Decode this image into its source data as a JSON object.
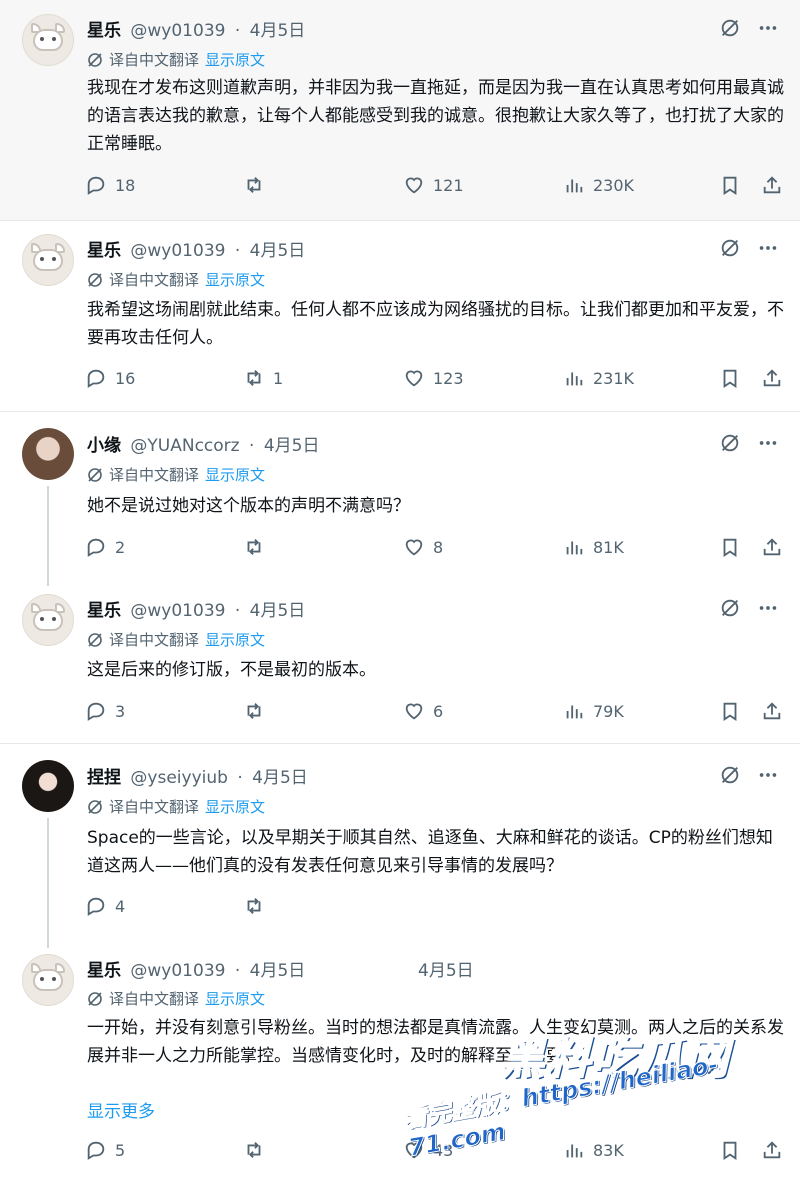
{
  "ui": {
    "translate_label": "译自中文翻译",
    "show_original_label": "显示原文",
    "show_more_label": "显示更多",
    "accent_color": "#1d9bf0",
    "muted_color": "#536471",
    "icons": [
      "translate-off-icon",
      "more-icon",
      "reply-icon",
      "retweet-icon",
      "like-icon",
      "views-icon",
      "bookmark-icon",
      "share-icon",
      "globe-icon"
    ]
  },
  "tweets": [
    {
      "name": "星乐",
      "handle": "@wy01039",
      "sep": "·",
      "date": "4月5日",
      "text": "我现在才发布这则道歉声明，并非因为我一直拖延，而是因为我一直在认真思考如何用最真诚的语言表达我的歉意，让每个人都能感受到我的诚意。很抱歉让大家久等了，也打扰了大家的正常睡眠。",
      "replies": "18",
      "retweets": "",
      "likes": "121",
      "views": "230K"
    },
    {
      "name": "星乐",
      "handle": "@wy01039",
      "sep": "·",
      "date": "4月5日",
      "text": "我希望这场闹剧就此结束。任何人都不应该成为网络骚扰的目标。让我们都更加和平友爱，不要再攻击任何人。",
      "replies": "16",
      "retweets": "1",
      "likes": "123",
      "views": "231K"
    },
    {
      "name": "小缘",
      "handle": "@YUANccorz",
      "sep": "·",
      "date": "4月5日",
      "text": "她不是说过她对这个版本的声明不满意吗？",
      "replies": "2",
      "retweets": "",
      "likes": "8",
      "views": "81K"
    },
    {
      "name": "星乐",
      "handle": "@wy01039",
      "sep": "·",
      "date": "4月5日",
      "text": "这是后来的修订版，不是最初的版本。",
      "replies": "3",
      "retweets": "",
      "likes": "6",
      "views": "79K"
    },
    {
      "name": "捏捏",
      "handle": "@yseiyyiub",
      "sep": "·",
      "date": "4月5日",
      "text": "Space的一些言论，以及早期关于顺其自然、追逐鱼、大麻和鲜花的谈话。CP的粉丝们想知道这两人——他们真的没有发表任何意见来引导事情的发展吗？",
      "replies": "4",
      "retweets": "",
      "likes": "",
      "views": ""
    },
    {
      "name": "星乐",
      "handle": "@wy01039",
      "sep": "·",
      "date": "4月5日",
      "text": "一开始，并没有刻意引导粉丝。当时的想法都是真情流露。人生变幻莫测。两人之后的关系发展并非一人之力所能掌控。当感情变化时，及时的解释至关重要。",
      "replies": "5",
      "retweets": "",
      "likes": "43",
      "views": "83K"
    }
  ],
  "ghost_date": "4月5日",
  "watermark": {
    "main": "黑料吃瓜网",
    "url": "看完整版：https://heiliao-71.com"
  }
}
